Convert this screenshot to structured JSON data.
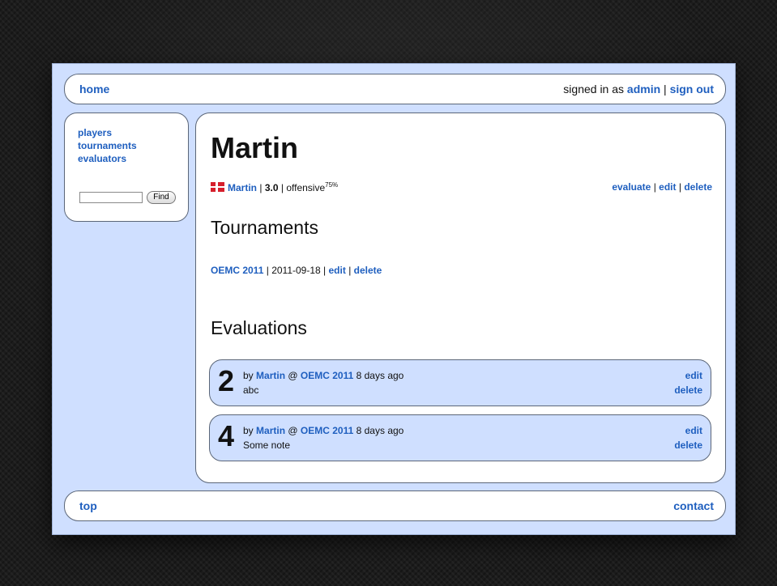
{
  "header": {
    "home": "home",
    "signed_in_prefix": "signed in as",
    "user": "admin",
    "sep": "|",
    "sign_out": "sign out"
  },
  "sidebar": {
    "items": [
      {
        "label": "players"
      },
      {
        "label": "tournaments"
      },
      {
        "label": "evaluators"
      }
    ],
    "search_value": "",
    "find_label": "Find"
  },
  "player": {
    "name": "Martin",
    "flag": "denmark-flag-icon",
    "link_name": "Martin",
    "rating": "3.0",
    "style": "offensive",
    "style_pct": "75%",
    "actions": {
      "evaluate": "evaluate",
      "edit": "edit",
      "delete": "delete"
    }
  },
  "tournaments": {
    "heading": "Tournaments",
    "items": [
      {
        "name": "OEMC 2011",
        "date": "2011-09-18",
        "edit": "edit",
        "delete": "delete"
      }
    ]
  },
  "evaluations": {
    "heading": "Evaluations",
    "items": [
      {
        "score": "2",
        "by": "by",
        "evaluator": "Martin",
        "at": "@",
        "tournament": "OEMC 2011",
        "ago": "8 days ago",
        "note": "abc",
        "edit": "edit",
        "delete": "delete"
      },
      {
        "score": "4",
        "by": "by",
        "evaluator": "Martin",
        "at": "@",
        "tournament": "OEMC 2011",
        "ago": "8 days ago",
        "note": "Some note",
        "edit": "edit",
        "delete": "delete"
      }
    ]
  },
  "footer": {
    "top": "top",
    "contact": "contact"
  },
  "colors": {
    "page_bg": "#cfdfff",
    "link": "#1f5fbf",
    "flag_red": "#d61f2c"
  }
}
